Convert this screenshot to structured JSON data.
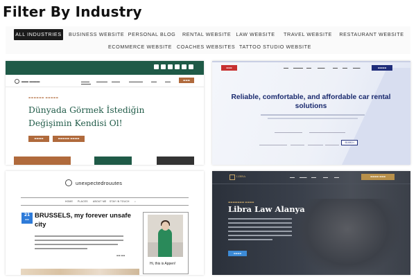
{
  "heading": "Filter By Industry",
  "filters": [
    {
      "label": "ALL INDUSTRIES",
      "active": true
    },
    {
      "label": "BUSINESS WEBSITE",
      "active": false
    },
    {
      "label": "PERSONAL BLOG",
      "active": false
    },
    {
      "label": "RENTAL WEBSITE",
      "active": false
    },
    {
      "label": "LAW WEBSITE",
      "active": false
    },
    {
      "label": "TRAVEL WEBSITE",
      "active": false
    },
    {
      "label": "RESTAURANT WEBSITE",
      "active": false
    },
    {
      "label": "ECOMMERCE WEBSITE",
      "active": false
    },
    {
      "label": "COACHES WEBSITES",
      "active": false
    },
    {
      "label": "TATTOO STUDIO WEBSITE",
      "active": false
    }
  ],
  "colors": {
    "active_filter_bg": "#1b1b1b",
    "business_green": "#1f5a47",
    "business_accent": "#b06a3c",
    "rental_navy": "#1a2a6e",
    "blog_blue": "#2e7bd9",
    "law_gold": "#b8904a"
  },
  "cards": {
    "business": {
      "hero": "Dünyada Görmek İstediğin Değişimin Kendisi Ol!"
    },
    "rental": {
      "title": "Reliable, comfortable, and affordable car rental solutions",
      "search_button": "SEARCH"
    },
    "blog": {
      "brand": "unexpectedrouutes",
      "nav": [
        "HOME",
        "PLACES",
        "ABOUT ME",
        "STAY IN TOUCH"
      ],
      "date_day": "21",
      "post_title": "BRUSSELS, my forever unsafe city",
      "sidebar_greeting": "Hi, this is Appen!"
    },
    "law": {
      "logo": "LIBRA",
      "title": "Libra Law Alanya"
    }
  }
}
